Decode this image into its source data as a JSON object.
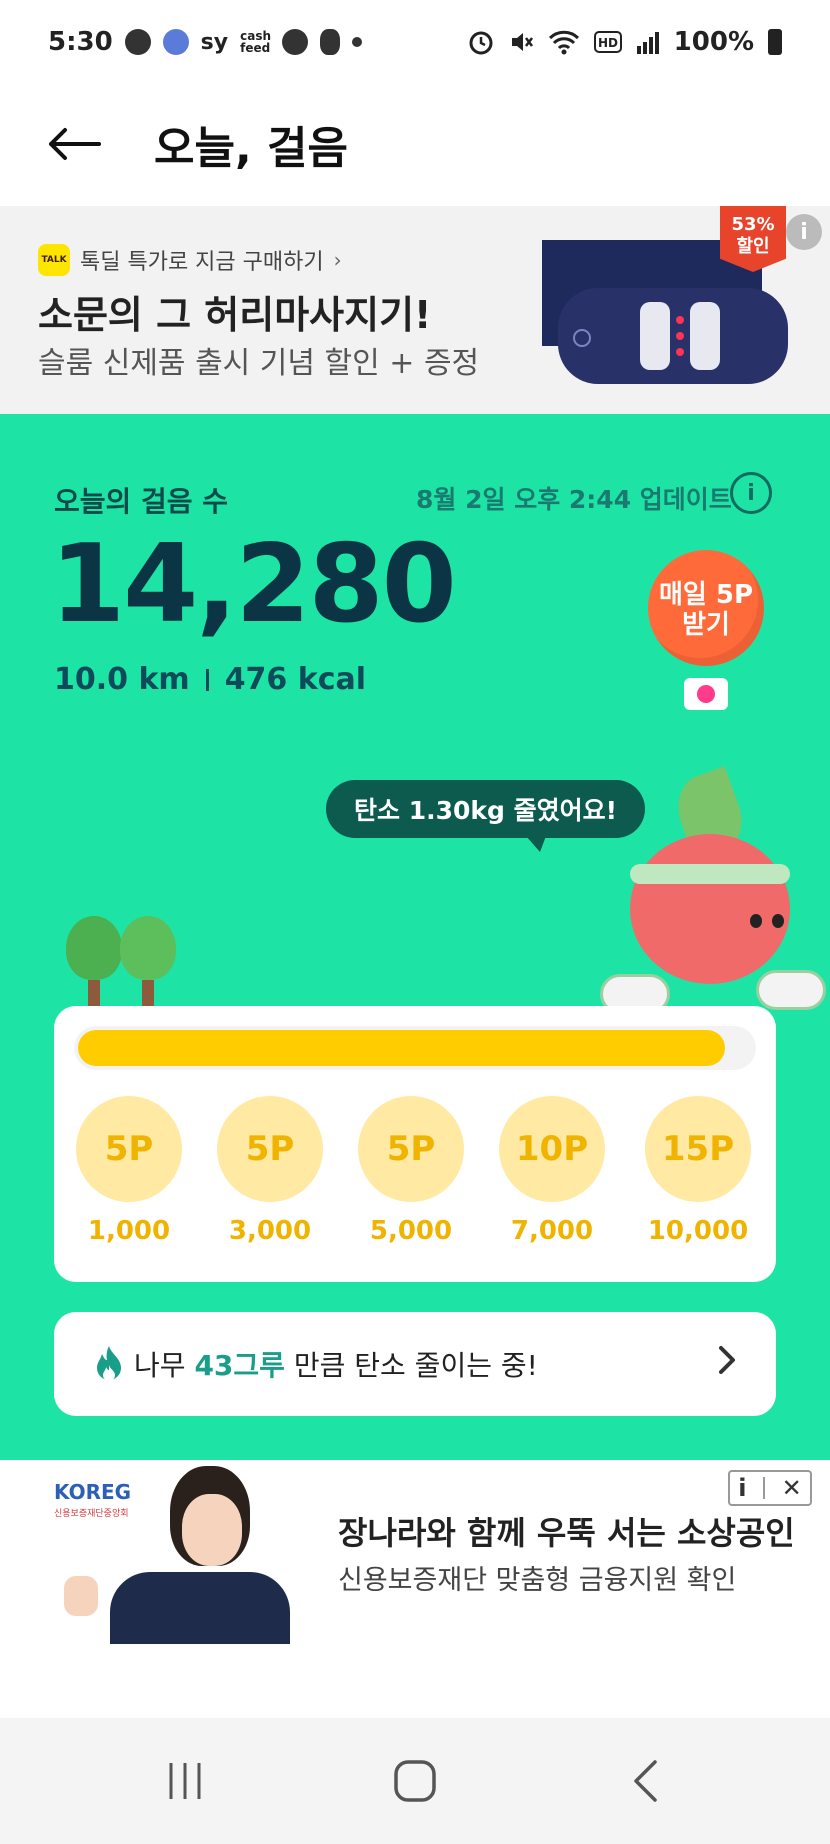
{
  "status_bar": {
    "time": "5:30",
    "app_text_sy": "sy",
    "app_text_cashfeed": "cash feed",
    "battery_percent": "100%"
  },
  "app_bar": {
    "title": "오늘, 걸음"
  },
  "ad_top": {
    "talk_badge": "TALK",
    "talk_text": "톡딜 특가로 지금 구매하기",
    "headline": "소문의 그 허리마사지기!",
    "subtext": "슬룸 신제품 출시 기념 할인 + 증정",
    "discount_percent": "53%",
    "discount_label": "할인",
    "info_icon": "i"
  },
  "steps": {
    "label": "오늘의 걸음 수",
    "updated": "8월 2일 오후 2:44 업데이트",
    "count": "14,280",
    "distance": "10.0 km",
    "calories": "476 kcal",
    "daily_button": "매일 5P 받기"
  },
  "carbon": {
    "speech": "탄소 1.30kg 줄였어요!"
  },
  "progress": {
    "fraction": 0.96,
    "milestones": [
      {
        "points": "5P",
        "steps": "1,000"
      },
      {
        "points": "5P",
        "steps": "3,000"
      },
      {
        "points": "5P",
        "steps": "5,000"
      },
      {
        "points": "10P",
        "steps": "7,000"
      },
      {
        "points": "15P",
        "steps": "10,000"
      }
    ]
  },
  "tree_card": {
    "prefix": "나무",
    "highlight": "43그루",
    "suffix": "만큼 탄소 줄이는 중!"
  },
  "ad_bottom": {
    "brand": "KOREG",
    "brand_sub": "신용보증재단중앙회",
    "title": "장나라와 함께 우뚝 서는 소상공인",
    "subtitle": "신용보증재단 맞춤형 금융지원 확인"
  },
  "colors": {
    "green_bg": "#1de4a4",
    "dark_teal": "#0b3445",
    "gold": "#ffcc00",
    "orange": "#ff6a3a"
  }
}
